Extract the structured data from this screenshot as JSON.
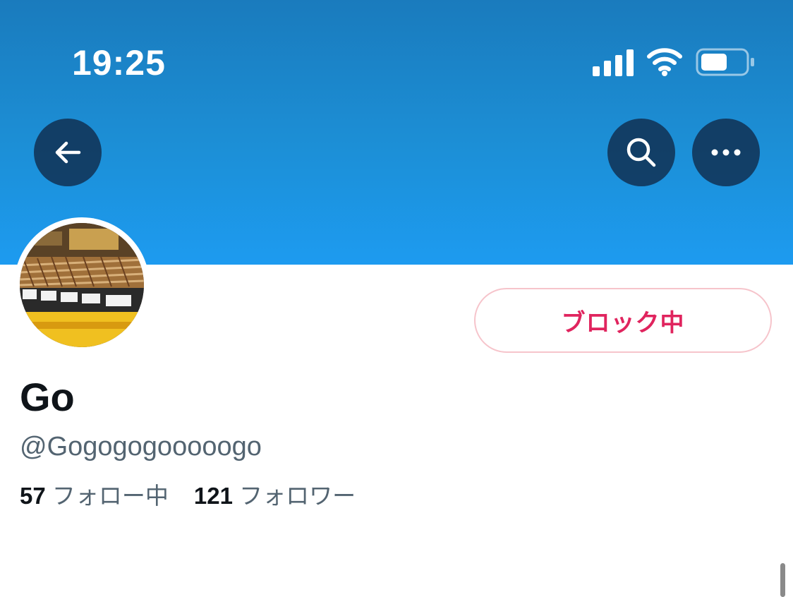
{
  "status_bar": {
    "time": "19:25",
    "icons": [
      "cellular-signal-icon",
      "wifi-icon",
      "battery-icon"
    ]
  },
  "nav": {
    "back_icon": "arrow-left-icon",
    "search_icon": "search-icon",
    "more_icon": "more-horizontal-icon"
  },
  "profile": {
    "display_name": "Go",
    "handle": "@Gogogogooooogo",
    "block_button_label": "ブロック中",
    "following_count": "57",
    "following_label": "フォロー中",
    "followers_count": "121",
    "followers_label": "フォロワー"
  },
  "colors": {
    "header_blue": "#1d9bf0",
    "block_red": "#e0245e",
    "block_border": "#f6c4cb",
    "secondary_text": "#536471",
    "primary_text": "#0f1419"
  }
}
